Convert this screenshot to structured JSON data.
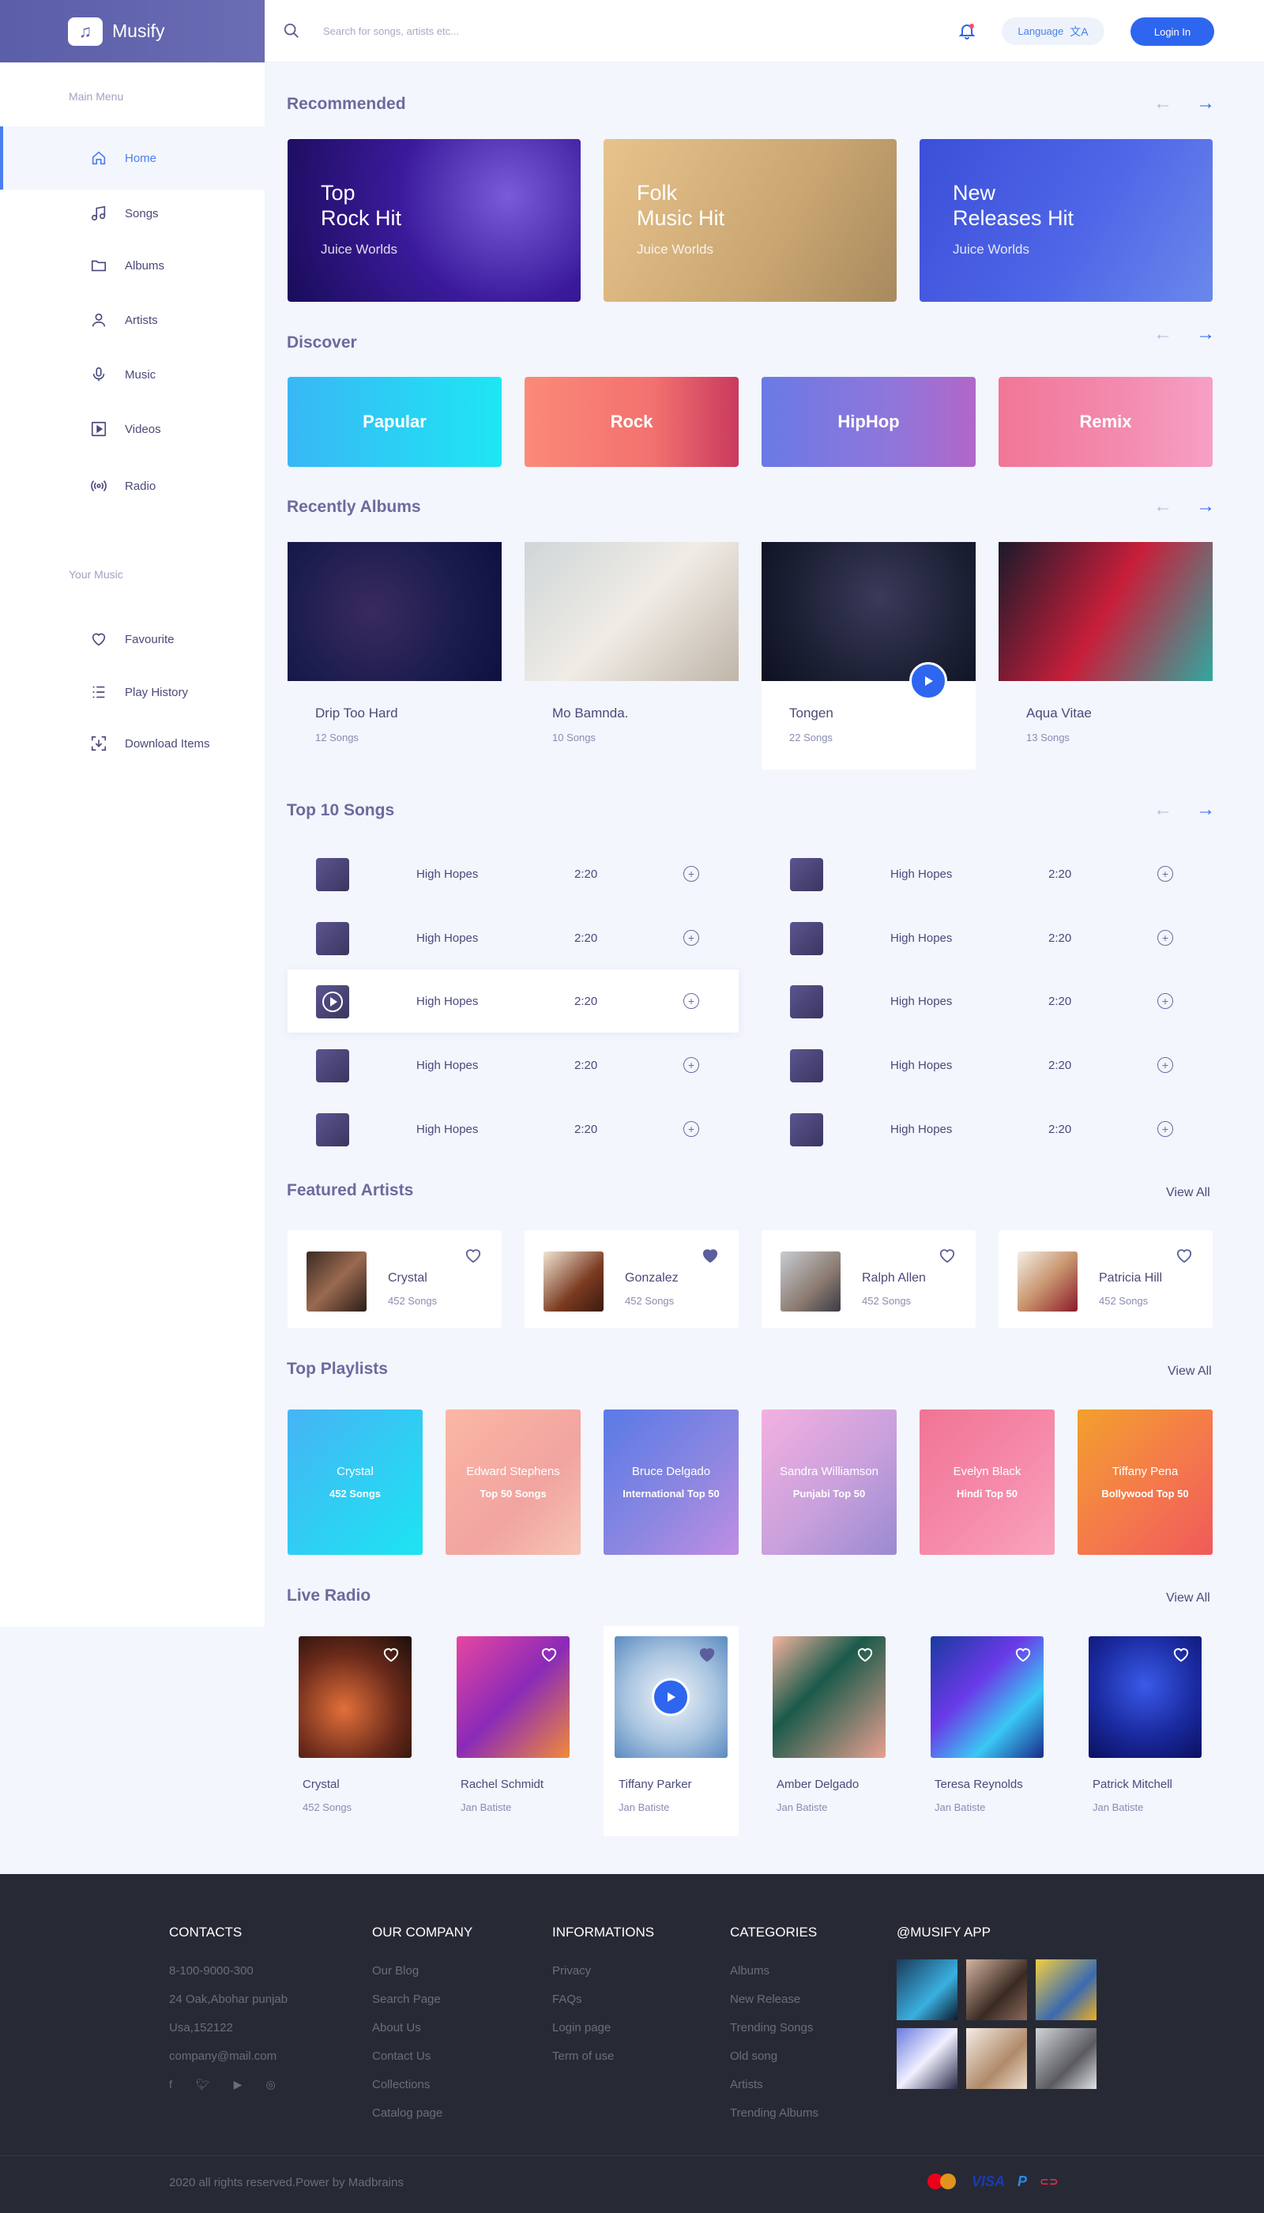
{
  "app": {
    "name": "Musify",
    "logo_icon": "music-note-icon"
  },
  "header": {
    "search_placeholder": "Search for songs, artists etc...",
    "language_label": "Language",
    "login_label": "Login In"
  },
  "sidebar": {
    "main_menu_title": "Main Menu",
    "items": [
      {
        "label": "Home",
        "icon": "home-icon"
      },
      {
        "label": "Songs",
        "icon": "music-note-icon"
      },
      {
        "label": "Albums",
        "icon": "folder-icon"
      },
      {
        "label": "Artists",
        "icon": "user-icon"
      },
      {
        "label": "Music",
        "icon": "microphone-icon"
      },
      {
        "label": "Videos",
        "icon": "video-icon"
      },
      {
        "label": "Radio",
        "icon": "radio-icon"
      }
    ],
    "your_music_title": "Your Music",
    "music_items": [
      {
        "label": "Favourite",
        "icon": "heart-icon"
      },
      {
        "label": "Play History",
        "icon": "list-icon"
      },
      {
        "label": "Download Items",
        "icon": "download-icon"
      }
    ]
  },
  "sections": {
    "recommended": "Recommended",
    "discover": "Discover",
    "recently_albums": "Recently Albums",
    "top_songs": "Top 10 Songs",
    "featured_artists": "Featured Artists",
    "top_playlists": "Top Playlists",
    "live_radio": "Live Radio",
    "view_all": "View All"
  },
  "recommended": [
    {
      "title": "Top\nRock Hit",
      "subtitle": "Juice Worlds"
    },
    {
      "title": "Folk\nMusic Hit",
      "subtitle": "Juice Worlds"
    },
    {
      "title": "New\nReleases Hit",
      "subtitle": "Juice Worlds"
    }
  ],
  "discover": [
    "Papular",
    "Rock",
    "HipHop",
    "Remix"
  ],
  "albums": [
    {
      "name": "Drip Too Hard",
      "count": "12 Songs"
    },
    {
      "name": "Mo Bamnda.",
      "count": "10 Songs"
    },
    {
      "name": "Tongen",
      "count": "22 Songs"
    },
    {
      "name": "Aqua Vitae",
      "count": "13 Songs"
    }
  ],
  "songs": {
    "name": "High Hopes",
    "time": "2:20"
  },
  "artists": [
    {
      "name": "Crystal",
      "count": "452 Songs",
      "liked": false
    },
    {
      "name": "Gonzalez",
      "count": "452 Songs",
      "liked": true
    },
    {
      "name": "Ralph Allen",
      "count": "452 Songs",
      "liked": false
    },
    {
      "name": "Patricia Hill",
      "count": "452 Songs",
      "liked": false
    }
  ],
  "playlists": [
    {
      "name": "Crystal",
      "sub": "452 Songs"
    },
    {
      "name": "Edward Stephens",
      "sub": "Top 50 Songs"
    },
    {
      "name": "Bruce Delgado",
      "sub": "International Top 50"
    },
    {
      "name": "Sandra Williamson",
      "sub": "Punjabi Top 50"
    },
    {
      "name": "Evelyn Black",
      "sub": "Hindi  Top 50"
    },
    {
      "name": "Tiffany Pena",
      "sub": "Bollywood Top 50"
    }
  ],
  "radio": [
    {
      "name": "Crystal",
      "sub": "452 Songs"
    },
    {
      "name": "Rachel Schmidt",
      "sub": "Jan Batiste"
    },
    {
      "name": "Tiffany Parker",
      "sub": "Jan Batiste"
    },
    {
      "name": "Amber Delgado",
      "sub": "Jan Batiste"
    },
    {
      "name": "Teresa Reynolds",
      "sub": "Jan Batiste"
    },
    {
      "name": "Patrick Mitchell",
      "sub": "Jan Batiste"
    }
  ],
  "footer": {
    "contacts_title": "CONTACTS",
    "contacts": [
      "8-100-9000-300",
      "24 Oak,Abohar punjab",
      "Usa,152122",
      "company@mail.com"
    ],
    "company_title": "OUR COMPANY",
    "company": [
      "Our Blog",
      "Search Page",
      "About Us",
      "Contact Us",
      "Collections",
      "Catalog page"
    ],
    "info_title": "INFORMATIONS",
    "info": [
      "Privacy",
      "FAQs",
      "Login page",
      "Term of use"
    ],
    "categories_title": "CATEGORIES",
    "categories": [
      "Albums",
      "New Release",
      "Trending Songs",
      "Old song",
      "Artists",
      "Trending Albums"
    ],
    "app_title": "@MUSIFY APP",
    "copyright": "2020 all rights reserved.Power by Madbrains",
    "social_icons": [
      "facebook-icon",
      "twitter-icon",
      "youtube-icon",
      "dribbble-icon"
    ]
  },
  "colors": {
    "accent": "#2f66ef",
    "brand": "#5b5ea8",
    "footer": "#272a35"
  }
}
